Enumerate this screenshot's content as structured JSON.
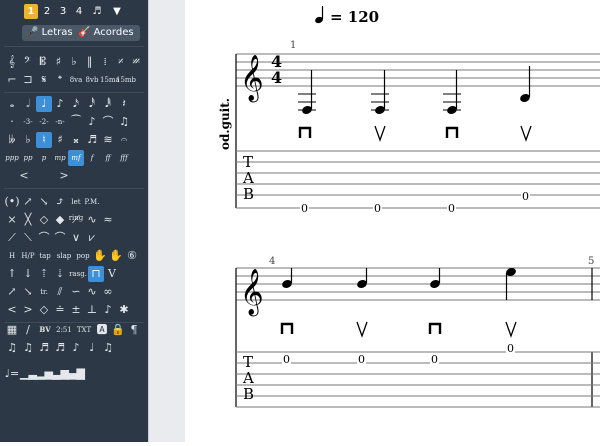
{
  "toolbar": {
    "voices": [
      "1",
      "2",
      "3",
      "4"
    ],
    "active_voice": "1",
    "flag_icon": "flag-icon",
    "dropdown_icon": "chevron-down-icon",
    "lyrics_label": "Letras",
    "chords_label": "Acordes"
  },
  "palette": {
    "row_dynamics": [
      "ppp",
      "pp",
      "p",
      "mp",
      "mf",
      "f",
      "ff",
      "fff"
    ],
    "selected_dynamic": "mf",
    "techniques": [
      "tap",
      "slap",
      "pop"
    ],
    "let_ring": "let ring",
    "palm_mute": "P.M.",
    "rasg": "rasg.",
    "tr": "tr.",
    "bv": "BV",
    "timer": "2:51",
    "txt": "TXT",
    "octave_marks": [
      "8va",
      "8vb",
      "15ma",
      "15mb"
    ]
  },
  "score": {
    "tempo": "= 120",
    "instrument": "od.guit.",
    "time_signature": [
      "4",
      "4"
    ],
    "measure_numbers": [
      "1",
      "4",
      "5"
    ],
    "tab_letters": [
      "T",
      "A",
      "B"
    ],
    "system1": {
      "tab_frets": [
        "0",
        "0",
        "0",
        "0"
      ],
      "strokes": [
        "down",
        "up",
        "down",
        "up"
      ]
    },
    "system2": {
      "tab_frets": [
        "0",
        "0",
        "0",
        "0"
      ],
      "strokes": [
        "down",
        "up",
        "down",
        "up"
      ]
    }
  },
  "colors": {
    "sidebar_bg": "#2c3845",
    "accent_voice": "#f0b429",
    "accent_selected": "#3d8fd8"
  }
}
